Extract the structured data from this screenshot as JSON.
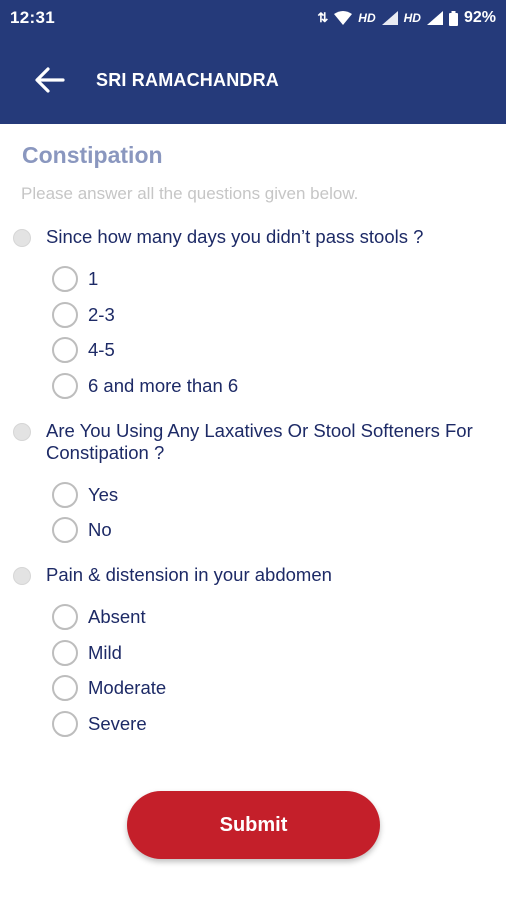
{
  "status_bar": {
    "time": "12:31",
    "hd1": "HD",
    "hd2": "HD",
    "battery": "92%"
  },
  "app_bar": {
    "title": "SRI RAMACHANDRA",
    "back_icon": "arrow-left-icon"
  },
  "form": {
    "heading": "Constipation",
    "subtitle": "Please answer all the questions given below.",
    "questions": [
      {
        "text": "Since how many days you didn’t pass stools ?",
        "options": [
          "1",
          "2-3",
          "4-5",
          "6 and more than 6"
        ]
      },
      {
        "text": "Are You Using Any Laxatives Or Stool Softeners For Constipation ?",
        "options": [
          "Yes",
          "No"
        ]
      },
      {
        "text": "Pain & distension in your abdomen",
        "options": [
          "Absent",
          "Mild",
          "Moderate",
          "Severe"
        ]
      }
    ],
    "submit_label": "Submit"
  },
  "colors": {
    "primary": "#253a7a",
    "accent": "#c41f2a",
    "heading": "#8a97bf",
    "text": "#1d2a66"
  }
}
